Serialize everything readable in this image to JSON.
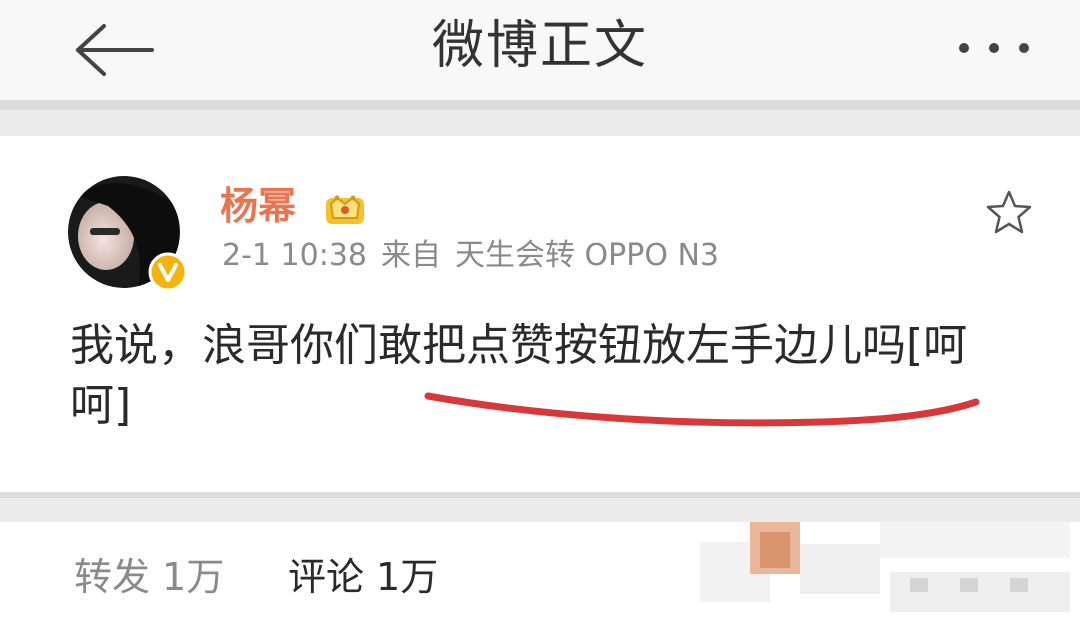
{
  "navbar": {
    "title": "微博正文",
    "back_icon": "arrow-left-icon",
    "more_icon": "more-horizontal-icon"
  },
  "post": {
    "author": "杨幂",
    "time": "2-1 10:38",
    "source_prefix": "来自",
    "source": "天生会转 OPPO N3",
    "text": "我说，浪哥你们敢把点赞按钮放左手边儿吗[呵呵]",
    "star_icon": "star-outline-icon",
    "vip_icon": "crown-vip-icon",
    "verified_icon": "verified-v-icon"
  },
  "stats": {
    "repost_label": "转发",
    "repost_count": "1万",
    "comment_label": "评论",
    "comment_count": "1万"
  },
  "colors": {
    "username": "#eb7350",
    "meta": "#8a8a8a",
    "text": "#2a2a2a",
    "separator": "#ececec",
    "annotation": "#d9383a",
    "badge": "#f5b40d"
  }
}
